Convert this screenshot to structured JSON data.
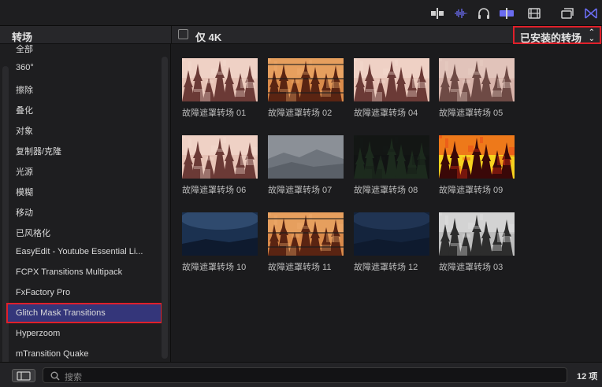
{
  "toolbar": {
    "icons": [
      "audio-split-icon",
      "audio-waveform-icon",
      "headphones-icon",
      "clip-skimming-icon",
      "filmstrip-icon",
      "window-layout-icon",
      "transitions-browser-icon"
    ],
    "accent": "#6a6cf0"
  },
  "header": {
    "sidebar_title": "转场",
    "only_4k_label": "仅 4K",
    "installed_dropdown": "已安装的转场"
  },
  "sidebar": {
    "items": [
      {
        "label": "全部"
      },
      {
        "label": "360°"
      },
      {
        "label": "擦除"
      },
      {
        "label": "叠化"
      },
      {
        "label": "对象"
      },
      {
        "label": "复制器/克隆"
      },
      {
        "label": "光源"
      },
      {
        "label": "模糊"
      },
      {
        "label": "移动"
      },
      {
        "label": "已风格化"
      },
      {
        "label": "EasyEdit - Youtube Essential Li..."
      },
      {
        "label": "FCPX Transitions Multipack"
      },
      {
        "label": "FxFactory Pro"
      },
      {
        "label": "Glitch Mask Transitions"
      },
      {
        "label": "Hyperzoom"
      },
      {
        "label": "mTransition Quake"
      }
    ],
    "selected": "Glitch Mask Transitions",
    "selected_color": "#34367a"
  },
  "grid": {
    "tiles": [
      {
        "label": "故障遮罩转场 01",
        "style": "forest-pink"
      },
      {
        "label": "故障遮罩转场 02",
        "style": "forest-orange-glitch"
      },
      {
        "label": "故障遮罩转场 04",
        "style": "forest-pink"
      },
      {
        "label": "故障遮罩转场 05",
        "style": "forest-pink-muted"
      },
      {
        "label": "故障遮罩转场 06",
        "style": "forest-pink"
      },
      {
        "label": "故障遮罩转场 07",
        "style": "misty-mountains"
      },
      {
        "label": "故障遮罩转场 08",
        "style": "dark-forest"
      },
      {
        "label": "故障遮罩转场 09",
        "style": "forest-red"
      },
      {
        "label": "故障遮罩转场 10",
        "style": "blue-night"
      },
      {
        "label": "故障遮罩转场 11",
        "style": "forest-orange-glitch"
      },
      {
        "label": "故障遮罩转场 12",
        "style": "blue-dark"
      },
      {
        "label": "故障遮罩转场 03",
        "style": "forest-gray"
      }
    ]
  },
  "bottom": {
    "search_placeholder": "搜索",
    "item_count": "12 项"
  }
}
